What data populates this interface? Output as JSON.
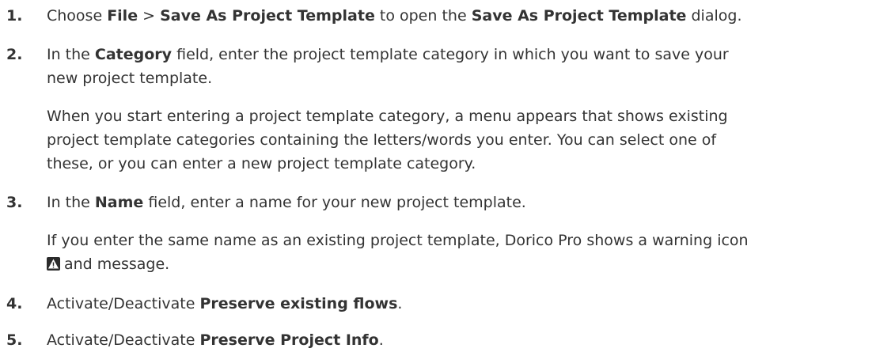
{
  "steps": [
    {
      "number": "1.",
      "parts": {
        "a": "Choose ",
        "b": "File",
        "c": " > ",
        "d": "Save As Project Template",
        "e": " to open the ",
        "f": "Save As Project Template",
        "g": " dialog."
      }
    },
    {
      "number": "2.",
      "parts": {
        "a": "In the ",
        "b": "Category",
        "c": " field, enter the project template category in which you want to save your",
        "d": "new project template."
      },
      "note_lines": [
        "When you start entering a project template category, a menu appears that shows existing",
        "project template categories containing the letters/words you enter. You can select one of",
        "these, or you can enter a new project template category."
      ]
    },
    {
      "number": "3.",
      "parts": {
        "a": "In the ",
        "b": "Name",
        "c": " field, enter a name for your new project template."
      },
      "note_lines": [
        "If you enter the same name as an existing project template, Dorico Pro shows a warning icon",
        "and message."
      ],
      "icon": "warning-icon"
    },
    {
      "number": "4.",
      "parts": {
        "a": "Activate/Deactivate ",
        "b": "Preserve existing flows",
        "c": "."
      }
    },
    {
      "number": "5.",
      "parts": {
        "a": "Activate/Deactivate ",
        "b": "Preserve Project Info",
        "c": "."
      }
    }
  ]
}
